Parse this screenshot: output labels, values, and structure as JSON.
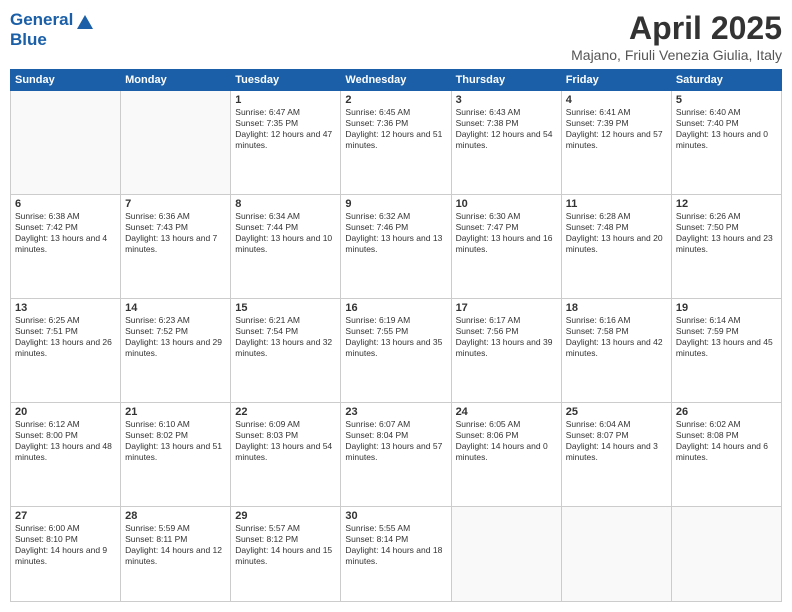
{
  "header": {
    "logo_line1": "General",
    "logo_line2": "Blue",
    "month": "April 2025",
    "location": "Majano, Friuli Venezia Giulia, Italy"
  },
  "weekdays": [
    "Sunday",
    "Monday",
    "Tuesday",
    "Wednesday",
    "Thursday",
    "Friday",
    "Saturday"
  ],
  "weeks": [
    [
      {
        "day": "",
        "info": ""
      },
      {
        "day": "",
        "info": ""
      },
      {
        "day": "1",
        "info": "Sunrise: 6:47 AM\nSunset: 7:35 PM\nDaylight: 12 hours and 47 minutes."
      },
      {
        "day": "2",
        "info": "Sunrise: 6:45 AM\nSunset: 7:36 PM\nDaylight: 12 hours and 51 minutes."
      },
      {
        "day": "3",
        "info": "Sunrise: 6:43 AM\nSunset: 7:38 PM\nDaylight: 12 hours and 54 minutes."
      },
      {
        "day": "4",
        "info": "Sunrise: 6:41 AM\nSunset: 7:39 PM\nDaylight: 12 hours and 57 minutes."
      },
      {
        "day": "5",
        "info": "Sunrise: 6:40 AM\nSunset: 7:40 PM\nDaylight: 13 hours and 0 minutes."
      }
    ],
    [
      {
        "day": "6",
        "info": "Sunrise: 6:38 AM\nSunset: 7:42 PM\nDaylight: 13 hours and 4 minutes."
      },
      {
        "day": "7",
        "info": "Sunrise: 6:36 AM\nSunset: 7:43 PM\nDaylight: 13 hours and 7 minutes."
      },
      {
        "day": "8",
        "info": "Sunrise: 6:34 AM\nSunset: 7:44 PM\nDaylight: 13 hours and 10 minutes."
      },
      {
        "day": "9",
        "info": "Sunrise: 6:32 AM\nSunset: 7:46 PM\nDaylight: 13 hours and 13 minutes."
      },
      {
        "day": "10",
        "info": "Sunrise: 6:30 AM\nSunset: 7:47 PM\nDaylight: 13 hours and 16 minutes."
      },
      {
        "day": "11",
        "info": "Sunrise: 6:28 AM\nSunset: 7:48 PM\nDaylight: 13 hours and 20 minutes."
      },
      {
        "day": "12",
        "info": "Sunrise: 6:26 AM\nSunset: 7:50 PM\nDaylight: 13 hours and 23 minutes."
      }
    ],
    [
      {
        "day": "13",
        "info": "Sunrise: 6:25 AM\nSunset: 7:51 PM\nDaylight: 13 hours and 26 minutes."
      },
      {
        "day": "14",
        "info": "Sunrise: 6:23 AM\nSunset: 7:52 PM\nDaylight: 13 hours and 29 minutes."
      },
      {
        "day": "15",
        "info": "Sunrise: 6:21 AM\nSunset: 7:54 PM\nDaylight: 13 hours and 32 minutes."
      },
      {
        "day": "16",
        "info": "Sunrise: 6:19 AM\nSunset: 7:55 PM\nDaylight: 13 hours and 35 minutes."
      },
      {
        "day": "17",
        "info": "Sunrise: 6:17 AM\nSunset: 7:56 PM\nDaylight: 13 hours and 39 minutes."
      },
      {
        "day": "18",
        "info": "Sunrise: 6:16 AM\nSunset: 7:58 PM\nDaylight: 13 hours and 42 minutes."
      },
      {
        "day": "19",
        "info": "Sunrise: 6:14 AM\nSunset: 7:59 PM\nDaylight: 13 hours and 45 minutes."
      }
    ],
    [
      {
        "day": "20",
        "info": "Sunrise: 6:12 AM\nSunset: 8:00 PM\nDaylight: 13 hours and 48 minutes."
      },
      {
        "day": "21",
        "info": "Sunrise: 6:10 AM\nSunset: 8:02 PM\nDaylight: 13 hours and 51 minutes."
      },
      {
        "day": "22",
        "info": "Sunrise: 6:09 AM\nSunset: 8:03 PM\nDaylight: 13 hours and 54 minutes."
      },
      {
        "day": "23",
        "info": "Sunrise: 6:07 AM\nSunset: 8:04 PM\nDaylight: 13 hours and 57 minutes."
      },
      {
        "day": "24",
        "info": "Sunrise: 6:05 AM\nSunset: 8:06 PM\nDaylight: 14 hours and 0 minutes."
      },
      {
        "day": "25",
        "info": "Sunrise: 6:04 AM\nSunset: 8:07 PM\nDaylight: 14 hours and 3 minutes."
      },
      {
        "day": "26",
        "info": "Sunrise: 6:02 AM\nSunset: 8:08 PM\nDaylight: 14 hours and 6 minutes."
      }
    ],
    [
      {
        "day": "27",
        "info": "Sunrise: 6:00 AM\nSunset: 8:10 PM\nDaylight: 14 hours and 9 minutes."
      },
      {
        "day": "28",
        "info": "Sunrise: 5:59 AM\nSunset: 8:11 PM\nDaylight: 14 hours and 12 minutes."
      },
      {
        "day": "29",
        "info": "Sunrise: 5:57 AM\nSunset: 8:12 PM\nDaylight: 14 hours and 15 minutes."
      },
      {
        "day": "30",
        "info": "Sunrise: 5:55 AM\nSunset: 8:14 PM\nDaylight: 14 hours and 18 minutes."
      },
      {
        "day": "",
        "info": ""
      },
      {
        "day": "",
        "info": ""
      },
      {
        "day": "",
        "info": ""
      }
    ]
  ]
}
